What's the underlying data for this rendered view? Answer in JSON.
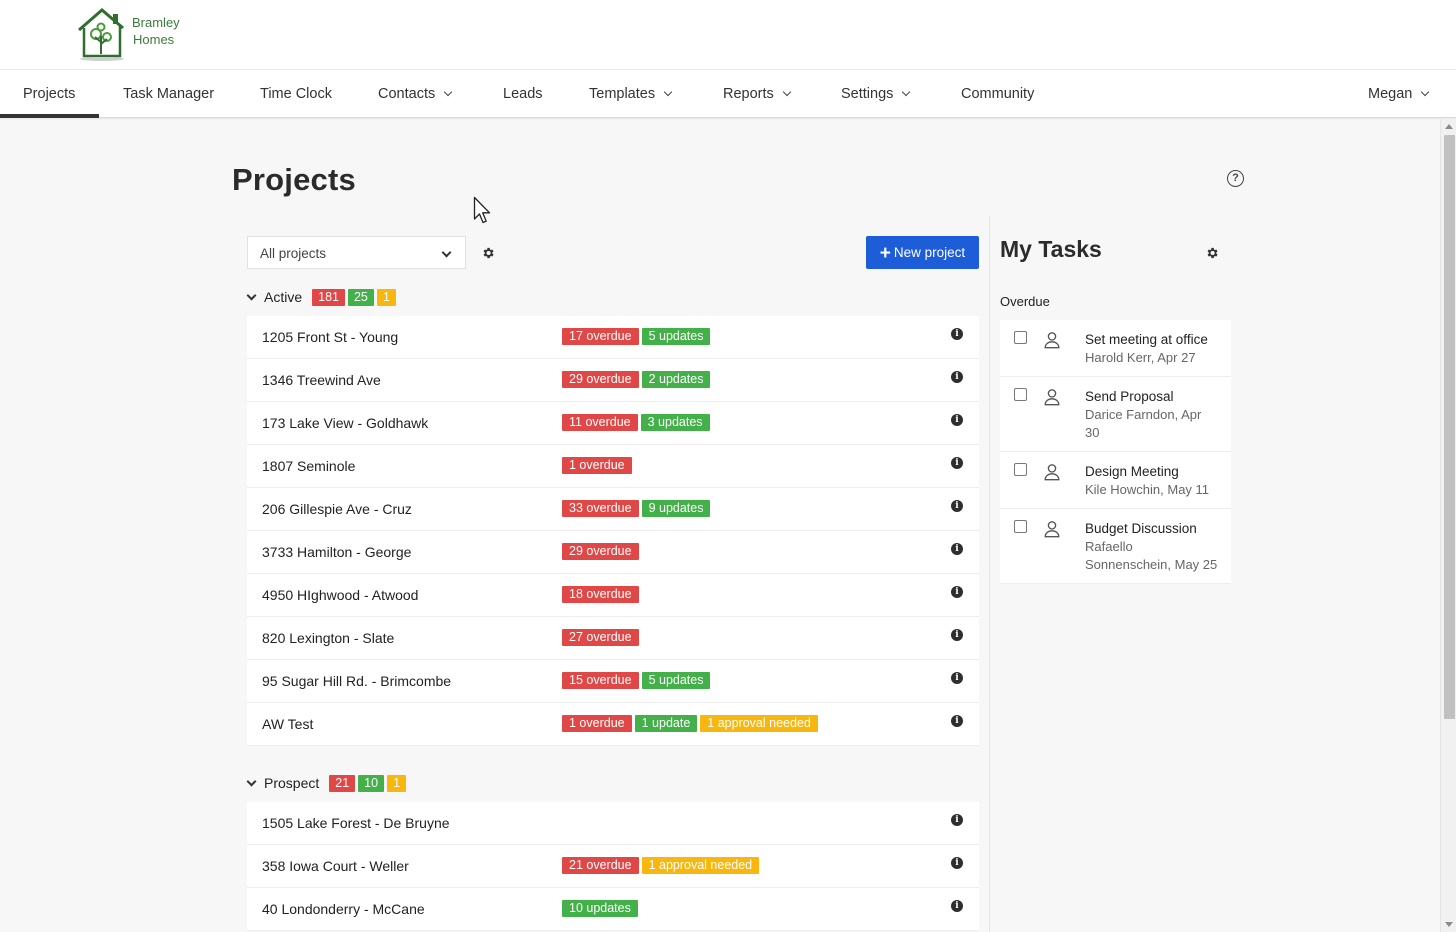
{
  "brand": {
    "line1": "Bramley",
    "line2": "Homes"
  },
  "nav": {
    "items": [
      {
        "label": "Projects",
        "dropdown": false,
        "active": true
      },
      {
        "label": "Task Manager",
        "dropdown": false
      },
      {
        "label": "Time Clock",
        "dropdown": false
      },
      {
        "label": "Contacts",
        "dropdown": true
      },
      {
        "label": "Leads",
        "dropdown": false
      },
      {
        "label": "Templates",
        "dropdown": true
      },
      {
        "label": "Reports",
        "dropdown": true
      },
      {
        "label": "Settings",
        "dropdown": true
      },
      {
        "label": "Community",
        "dropdown": false
      }
    ],
    "user": "Megan"
  },
  "page": {
    "title": "Projects",
    "filter_value": "All projects",
    "new_project_label": "New project"
  },
  "groups": [
    {
      "name": "Active",
      "counts": {
        "red": "181",
        "green": "25",
        "yellow": "1"
      },
      "projects": [
        {
          "name": "1205 Front St - Young",
          "overdue": "17 overdue",
          "updates": "5 updates"
        },
        {
          "name": "1346 Treewind Ave",
          "overdue": "29 overdue",
          "updates": "2 updates"
        },
        {
          "name": "173 Lake View - Goldhawk",
          "overdue": "11 overdue",
          "updates": "3 updates"
        },
        {
          "name": "1807 Seminole",
          "overdue": "1 overdue"
        },
        {
          "name": "206 Gillespie Ave - Cruz",
          "overdue": "33 overdue",
          "updates": "9 updates"
        },
        {
          "name": "3733 Hamilton - George",
          "overdue": "29 overdue"
        },
        {
          "name": "4950 HIghwood - Atwood",
          "overdue": "18 overdue"
        },
        {
          "name": "820 Lexington - Slate",
          "overdue": "27 overdue"
        },
        {
          "name": "95 Sugar Hill Rd. - Brimcombe",
          "overdue": "15 overdue",
          "updates": "5 updates"
        },
        {
          "name": "AW Test",
          "overdue": "1 overdue",
          "updates": "1 update",
          "approval": "1 approval needed"
        }
      ]
    },
    {
      "name": "Prospect",
      "counts": {
        "red": "21",
        "green": "10",
        "yellow": "1"
      },
      "projects": [
        {
          "name": "1505 Lake Forest - De Bruyne"
        },
        {
          "name": "358 Iowa Court - Weller",
          "overdue": "21 overdue",
          "approval": "1 approval needed"
        },
        {
          "name": "40 Londonderry - McCane",
          "updates": "10 updates"
        }
      ]
    }
  ],
  "tasks": {
    "title": "My Tasks",
    "section": "Overdue",
    "items": [
      {
        "title": "Set meeting at office",
        "sub": "Harold Kerr, Apr 27"
      },
      {
        "title": "Send Proposal",
        "sub": "Darice Farndon, Apr 30"
      },
      {
        "title": "Design Meeting",
        "sub": "Kile Howchin, May 11"
      },
      {
        "title": "Budget Discussion",
        "sub": "Rafaello Sonnenschein, May 25"
      }
    ]
  },
  "colors": {
    "accent": "#1d5ed8",
    "overdue": "#e04848",
    "updates": "#43b049",
    "approval": "#f7b70f",
    "brand": "#3a7d3a"
  }
}
